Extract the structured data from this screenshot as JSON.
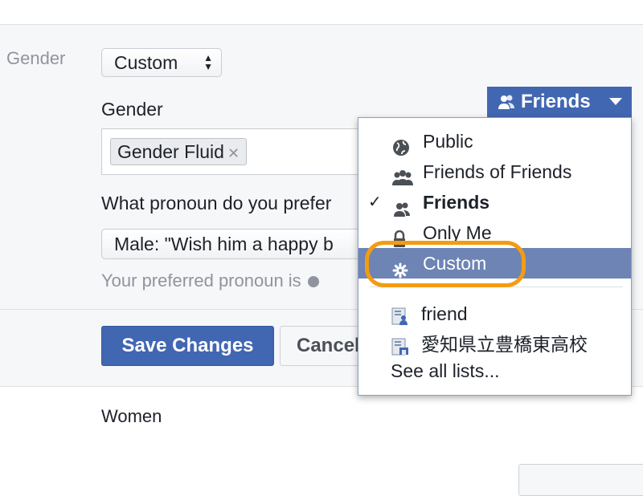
{
  "colors": {
    "accent": "#4267b2",
    "highlight": "#6d84b4",
    "annotation_ring": "#f39c12",
    "muted_text": "#90949c"
  },
  "form": {
    "row_label": "Gender",
    "gender_select_value": "Custom",
    "gender_field_label": "Gender",
    "gender_token": "Gender Fluid",
    "pronoun_question": "What pronoun do you prefer",
    "pronoun_select_value": "Male: \"Wish him a happy b",
    "pronoun_hint": "Your preferred pronoun is",
    "save_label": "Save Changes",
    "cancel_label": "Cancel"
  },
  "section_below": {
    "label": "Women"
  },
  "audience": {
    "selected_label": "Friends",
    "options": [
      {
        "label": "Public",
        "icon": "globe-icon"
      },
      {
        "label": "Friends of Friends",
        "icon": "friends-of-friends-icon"
      },
      {
        "label": "Friends",
        "icon": "friends-icon",
        "checked": true
      },
      {
        "label": "Only Me",
        "icon": "lock-icon"
      },
      {
        "label": "Custom",
        "icon": "gear-icon",
        "highlighted": true
      }
    ],
    "lists": [
      {
        "label": "friend",
        "icon": "list-icon"
      },
      {
        "label": "愛知県立豊橋東高校",
        "icon": "school-list-icon"
      }
    ],
    "see_all_label": "See all lists..."
  }
}
